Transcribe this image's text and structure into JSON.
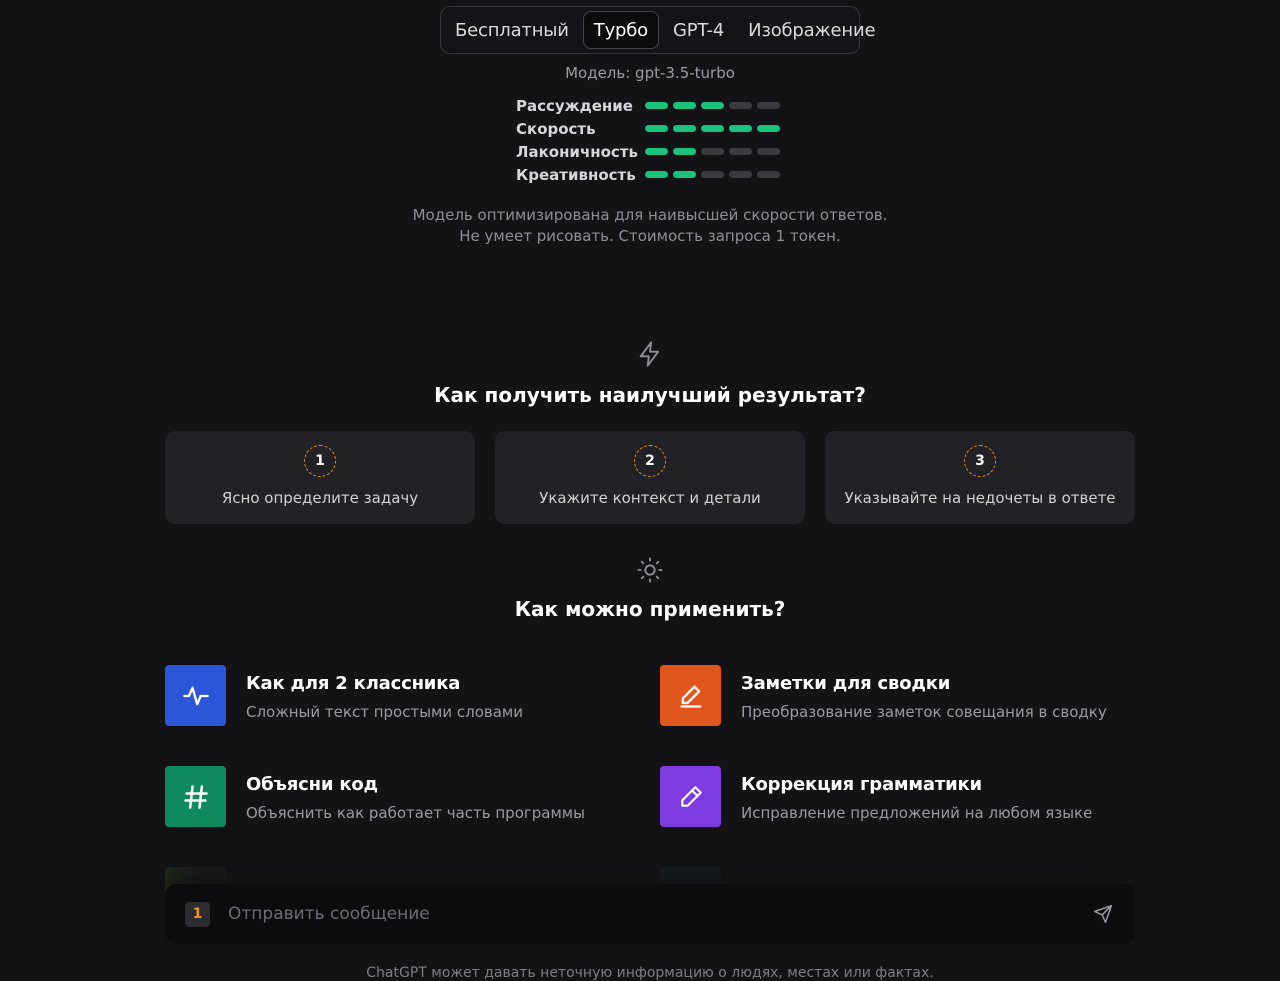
{
  "tabs": [
    {
      "label": "Бесплатный",
      "active": false
    },
    {
      "label": "Турбо",
      "active": true
    },
    {
      "label": "GPT-4",
      "active": false
    },
    {
      "label": "Изображение",
      "active": false
    }
  ],
  "model": {
    "label": "Модель: gpt-3.5-turbo",
    "ratings": [
      {
        "label": "Рассуждение",
        "level": 3,
        "max": 5
      },
      {
        "label": "Скорость",
        "level": 5,
        "max": 5
      },
      {
        "label": "Лаконичность",
        "level": 2,
        "max": 5
      },
      {
        "label": "Креативность",
        "level": 2,
        "max": 5
      }
    ],
    "description_line1": "Модель оптимизирована для наивысшей скорости ответов.",
    "description_line2": "Не умеет рисовать. Стоимость запроса 1 токен."
  },
  "tips_section": {
    "icon": "lightning-icon",
    "title": "Как получить наилучший результат?",
    "items": [
      {
        "number": "1",
        "text": "Ясно определите задачу"
      },
      {
        "number": "2",
        "text": "Укажите контекст и детали"
      },
      {
        "number": "3",
        "text": "Указывайте на недочеты в ответе"
      }
    ]
  },
  "uses_section": {
    "icon": "sun-icon",
    "title": "Как можно применить?",
    "items": [
      {
        "title": "Как для 2 классника",
        "subtitle": "Сложный текст простыми словами",
        "icon": "activity-icon",
        "color": "#2d55d8"
      },
      {
        "title": "Заметки для сводки",
        "subtitle": "Преобразование заметок совещания в сводку",
        "icon": "pen-edit-icon",
        "color": "#e0561d"
      },
      {
        "title": "Объясни код",
        "subtitle": "Объяснить как работает часть программы",
        "icon": "hash-icon",
        "color": "#0f8a5f"
      },
      {
        "title": "Коррекция грамматики",
        "subtitle": "Исправление предложений на любом языке",
        "icon": "pencil-icon",
        "color": "#7d3be0"
      }
    ],
    "partial_colors": [
      "#4a6b2a",
      "#1f5b55"
    ]
  },
  "composer": {
    "badge": "1",
    "placeholder": "Отправить сообщение",
    "send_icon": "send-icon"
  },
  "disclaimer": "ChatGPT может давать неточную информацию о людях, местах или фактах."
}
